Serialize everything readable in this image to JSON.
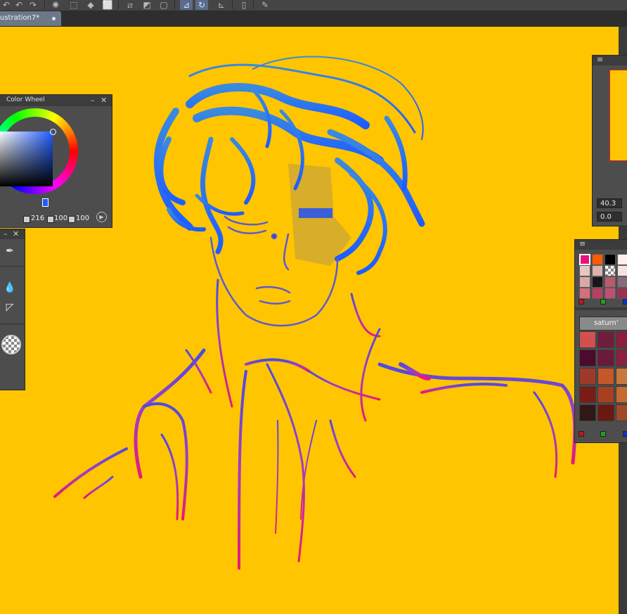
{
  "window": {
    "document_tab": {
      "label": "ustration7*"
    }
  },
  "toolbar": {
    "icons": [
      "undo-icon",
      "redo-icon",
      "loading-icon",
      "transform-icon",
      "fill-icon",
      "select-icon",
      "clear-selection-icon",
      "deselect-icon",
      "invert-icon",
      "ruler-snap-icon",
      "curve-snap-icon",
      "special-ruler-icon",
      "device-icon",
      "pen-settings-icon"
    ]
  },
  "color_wheel": {
    "title": "Color Wheel",
    "hue": "216",
    "saturation": "100",
    "value": "100",
    "current_color": "#1e5cff"
  },
  "tool_panel": {
    "tools": [
      "eyedropper-icon",
      "blend-icon",
      "gradient-icon",
      "transparent-color-icon"
    ]
  },
  "navigator": {
    "zoom": "40.3",
    "rotation": "0.0"
  },
  "color_palette": {
    "quick_colors": [
      "#e8137a",
      "#ff5a00",
      "#000000",
      "#fff0ee",
      "#e6c7c2",
      "#d9b3ad",
      "transparent",
      "#f2e3e1",
      "#dca7a4",
      "#1a1418",
      "#b85b6c",
      "#8a6a7a",
      "#d27080",
      "#b84060",
      "#c05070",
      "#9a3050"
    ],
    "set_name": "saturn’",
    "set_colors": [
      "#d45050",
      "#6e1e3c",
      "#8c1e3c",
      "#4c0a2c",
      "#6a1a3c",
      "#8c2040",
      "#9e3a2a",
      "#c4582a",
      "#c87a3c",
      "#7a1c14",
      "#a84020",
      "#c86a30",
      "#301818",
      "#6a1810",
      "#a04a28"
    ]
  },
  "colors": {
    "canvas_background": "#ffc500",
    "hair_stroke": "#1e60ff",
    "body_stroke_top": "#6a40d0",
    "body_stroke_bottom": "#e01a70"
  }
}
